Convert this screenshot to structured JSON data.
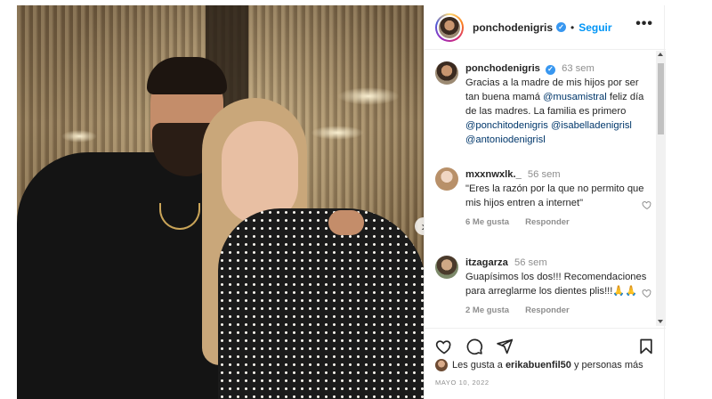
{
  "post": {
    "username": "ponchodenigris",
    "follow_label": "Seguir",
    "dot": "•",
    "more_label": "•••",
    "next_label": "›",
    "caption": {
      "username": "ponchodenigris",
      "time": "63 sem",
      "text_1": "Gracias a la madre de mis hijos por ser tan buena mamá",
      "mention_1": "@musamistral",
      "text_2": "feliz día de las madres. La familia es primero",
      "mention_2": "@ponchitodenigris",
      "mention_3": "@isabelladenigrisl",
      "mention_4": "@antoniodenigrisl"
    },
    "comments": [
      {
        "username": "mxxnwxlk._",
        "time": "56 sem",
        "text": "\"Eres la razón por la que no permito que mis hijos entren a internet\"",
        "likes": "6 Me gusta",
        "reply_label": "Responder"
      },
      {
        "username": "itzagarza",
        "time": "56 sem",
        "text": "Guapísimos los dos!!! Recomendaciones para arreglarme los dientes plis!!!🙏🙏",
        "likes": "2 Me gusta",
        "reply_label": "Responder"
      }
    ],
    "likes_prefix": "Les gusta a",
    "likes_user": "erikabuenfil50",
    "likes_suffix": "y personas más",
    "date": "MAYO 10, 2022"
  },
  "colors": {
    "link_blue": "#0095f6",
    "mention_navy": "#00376b",
    "secondary_text": "#8e8e8e",
    "primary_text": "#262626",
    "verified_blue": "#3897f0"
  },
  "icons": [
    "verified-badge-icon",
    "more-options-icon",
    "next-arrow-icon",
    "heart-icon",
    "comment-icon",
    "share-icon",
    "save-bookmark-icon"
  ]
}
